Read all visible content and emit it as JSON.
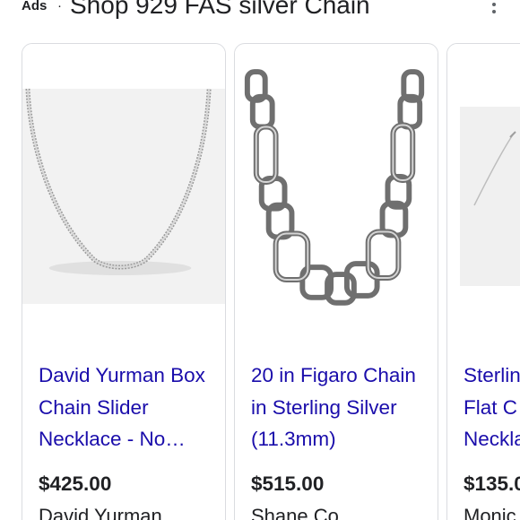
{
  "header": {
    "ads_label": "Ads",
    "separator": "·",
    "title": "Shop 929 FAS silver Chain",
    "more_icon": "more-vert-icon"
  },
  "products": [
    {
      "title": "David Yurman Box Chain Slider Necklace - No…",
      "price": "$425.00",
      "seller": "David Yurman"
    },
    {
      "title": "20 in Figaro Chain in Sterling Silver (11.3mm)",
      "price": "$515.00",
      "seller": "Shane Co."
    },
    {
      "title": "Sterlin\nFlat C\nNeckla",
      "price": "$135.0",
      "seller": "Monic"
    }
  ]
}
